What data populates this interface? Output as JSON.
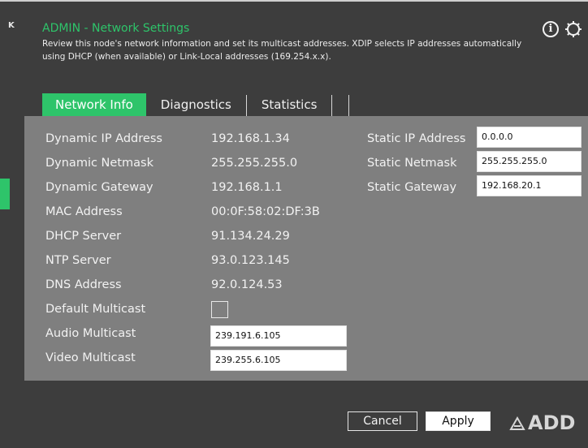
{
  "header": {
    "back_label": "K",
    "title": "ADMIN - Network Settings",
    "description": "Review this node's network information and set its multicast addresses. XDIP selects IP addresses automatically using DHCP (when available) or Link-Local addresses (169.254.x.x)."
  },
  "icons": {
    "info": "info-icon",
    "settings": "gear-icon",
    "logo_mark": "adder-logo-icon"
  },
  "tabs": [
    {
      "label": "Network Info",
      "active": true
    },
    {
      "label": "Diagnostics",
      "active": false
    },
    {
      "label": "Statistics",
      "active": false
    }
  ],
  "network_info": {
    "dynamic_ip": {
      "label": "Dynamic IP Address",
      "value": "192.168.1.34"
    },
    "dynamic_netmask": {
      "label": "Dynamic Netmask",
      "value": "255.255.255.0"
    },
    "dynamic_gateway": {
      "label": "Dynamic Gateway",
      "value": "192.168.1.1"
    },
    "mac": {
      "label": "MAC Address",
      "value": "00:0F:58:02:DF:3B"
    },
    "dhcp": {
      "label": "DHCP Server",
      "value": "91.134.24.29"
    },
    "ntp": {
      "label": "NTP Server",
      "value": "93.0.123.145"
    },
    "dns": {
      "label": "DNS Address",
      "value": "92.0.124.53"
    },
    "default_multicast": {
      "label": "Default Multicast",
      "checked": false
    },
    "audio_multicast": {
      "label": "Audio Multicast",
      "value": "239.191.6.105"
    },
    "video_multicast": {
      "label": "Video Multicast",
      "value": "239.255.6.105"
    }
  },
  "static": {
    "ip": {
      "label": "Static IP Address",
      "value": "0.0.0.0"
    },
    "netmask": {
      "label": "Static Netmask",
      "value": "255.255.255.0"
    },
    "gateway": {
      "label": "Static Gateway",
      "value": "192.168.20.1"
    }
  },
  "buttons": {
    "cancel": "Cancel",
    "apply": "Apply"
  },
  "brand": {
    "logo_text": "ADD"
  },
  "colors": {
    "accent": "#2ec46a",
    "background": "#3d3d3d",
    "panel": "#7f7f7f"
  }
}
